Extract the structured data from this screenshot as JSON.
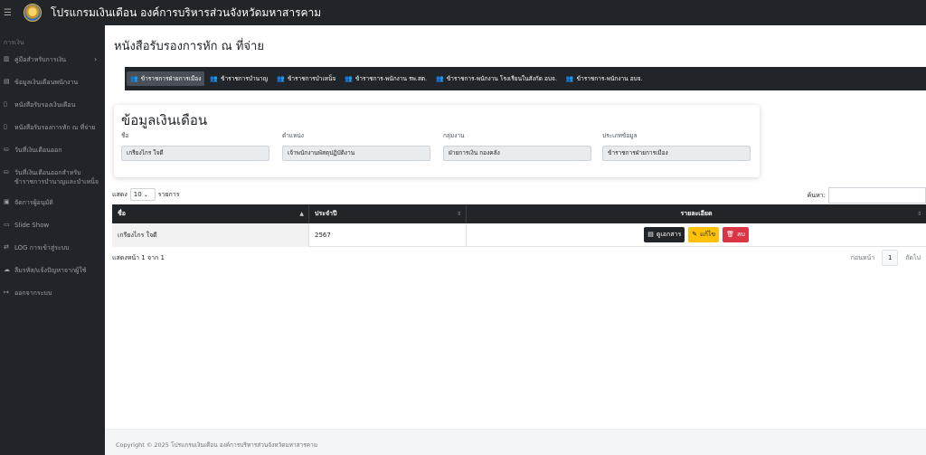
{
  "topbar": {
    "menu_icon": "hamburger-icon",
    "logo_icon": "organization-seal-icon",
    "title": "โปรแกรมเงินเดือน องค์การบริหารส่วนจังหวัดมหาสารคาม"
  },
  "sidebar": {
    "heading": "การเงิน",
    "items": [
      {
        "label": "คู่มือสำหรับการเงิน",
        "icon": "book-icon",
        "chevron": "›"
      },
      {
        "label": "ข้อมูลเงินเดือนพนักงาน",
        "icon": "id-card-icon"
      },
      {
        "label": "หนังสือรับรองเงินเดือน",
        "icon": "document-icon"
      },
      {
        "label": "หนังสือรับรองการหัก ณ ที่จ่าย",
        "icon": "document-icon"
      },
      {
        "label": "วันที่เงินเดือนออก",
        "icon": "calendar-icon"
      },
      {
        "label": "วันที่เงินเดือนออกสำหรับข้าราชการบำนาญและบำเหน็จ",
        "icon": "calendar-icon"
      },
      {
        "label": "จัดการผู้อนุมัติ",
        "icon": "user-check-icon"
      },
      {
        "label": "Slide Show",
        "icon": "monitor-icon"
      },
      {
        "label": "LOG การเข้าสู่ระบบ",
        "icon": "exchange-icon"
      },
      {
        "label": "ลืมรหัส/แจ้งปัญหาจากผู้ใช้",
        "icon": "cloud-icon"
      },
      {
        "label": "ออกจากระบบ",
        "icon": "logout-icon"
      }
    ]
  },
  "main": {
    "page_title": "หนังสือรับรองการหัก ณ ที่จ่าย",
    "tabs": [
      {
        "label": "ข้าราชการฝ่ายการเมือง",
        "icon": "users-icon",
        "active": true
      },
      {
        "label": "ข้าราชการบำนาญ",
        "icon": "users-icon"
      },
      {
        "label": "ข้าราชการบำเหน็จ",
        "icon": "users-icon"
      },
      {
        "label": "ข้าราชการ-พนักงาน รพ.สต.",
        "icon": "users-icon"
      },
      {
        "label": "ข้าราชการ-พนักงาน โรงเรียนในสังกัด อบจ.",
        "icon": "users-icon"
      },
      {
        "label": "ข้าราชการ-พนักงาน อบจ.",
        "icon": "users-icon"
      }
    ],
    "info_card": {
      "title": "ข้อมูลเงินเดือน",
      "fields": [
        {
          "label": "ชื่อ",
          "value": "เกรียงไกร ใจดี"
        },
        {
          "label": "ตำแหน่ง",
          "value": "เจ้าพนักงานพัสดุปฏิบัติงาน"
        },
        {
          "label": "กลุ่มงาน",
          "value": "ฝ่ายการเงิน กองคลัง"
        },
        {
          "label": "ประเภทข้อมูล",
          "value": "ข้าราชการฝ่ายการเมือง"
        }
      ]
    },
    "table_controls": {
      "show_prefix": "แสดง",
      "page_length": "10",
      "show_suffix": "รายการ",
      "search_label": "ค้นหา:",
      "search_value": ""
    },
    "table": {
      "columns": [
        "ชื่อ",
        "ประจำปี",
        "รายละเอียด"
      ],
      "rows": [
        {
          "name": "เกรียงไกร ใจดี",
          "year": "2567"
        }
      ],
      "actions": {
        "view": "ดูเอกสาร",
        "edit": "แก้ไข",
        "delete": "ลบ"
      }
    },
    "pagination": {
      "info": "แสดงหน้า 1 จาก 1",
      "prev": "ก่อนหน้า",
      "current": "1",
      "next": "ถัดไป"
    }
  },
  "footer": {
    "text": "Copyright © 2025 โปรแกรมเงินเดือน องค์การบริหารส่วนจังหวัดมหาสารคาม"
  },
  "colors": {
    "dark": "#212529",
    "warning": "#ffc107",
    "danger": "#dc3545"
  }
}
